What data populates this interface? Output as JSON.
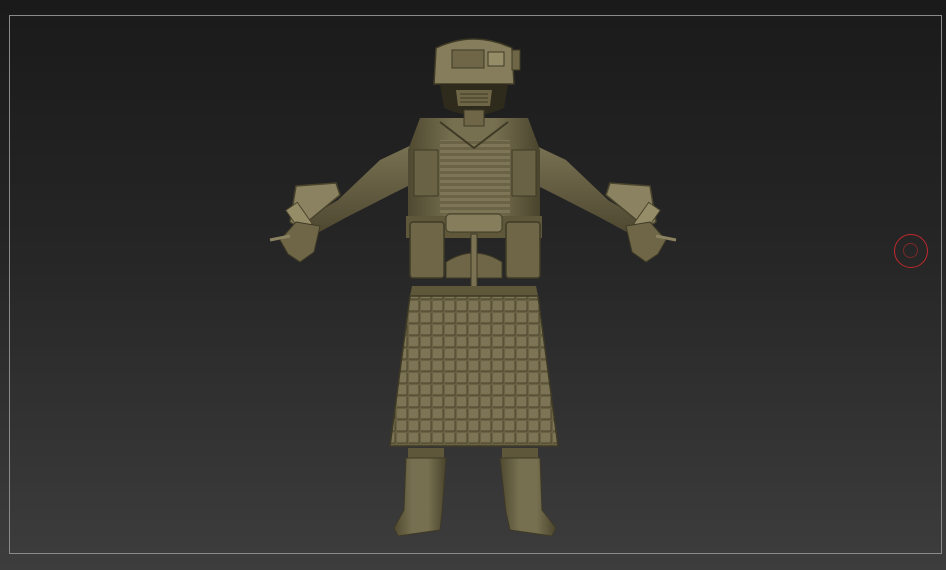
{
  "viewport": {
    "background_top": "#1a1a1a",
    "background_bottom": "#3d3d3d",
    "frame_color": "#8a8a8a"
  },
  "model": {
    "name": "armored-soldier-sculpt",
    "material_color": "#6e6647",
    "shadow_color": "#3f3a26",
    "highlight_color": "#9a916c"
  },
  "gizmo": {
    "icon": "rotation-gizmo-icon",
    "color": "#c0282c"
  }
}
